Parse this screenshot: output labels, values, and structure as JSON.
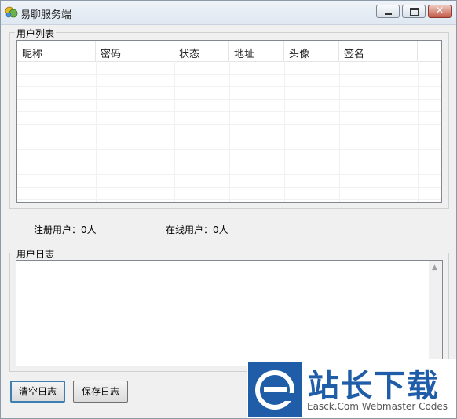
{
  "window": {
    "title": "易聊服务端"
  },
  "user_list": {
    "group_label": "用户列表",
    "columns": [
      "昵称",
      "密码",
      "状态",
      "地址",
      "头像",
      "签名"
    ],
    "rows": []
  },
  "stats": {
    "registered_label": "注册用户：",
    "registered_count": "0人",
    "online_label": "在线用户：",
    "online_count": "0人"
  },
  "user_log": {
    "group_label": "用户日志",
    "content": ""
  },
  "buttons": {
    "clear_log": "清空日志",
    "save_log": "保存日志"
  },
  "watermark": {
    "title": "站长下载",
    "subtitle": "Easck.Com Webmaster Codes"
  },
  "colors": {
    "accent": "#3c7fb1",
    "watermark_blue": "#1f5da8"
  }
}
